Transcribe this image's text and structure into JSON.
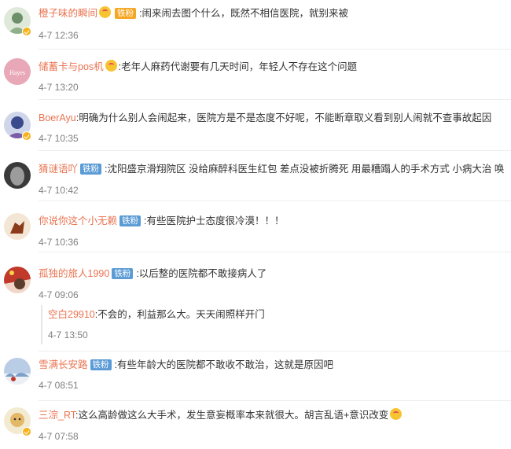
{
  "comments": [
    {
      "user": "橙子味的瞬间",
      "badge": "铁粉",
      "badge_style": "hot",
      "has_emoji": true,
      "text": ":闹来闹去图个什么，既然不相信医院，就别来被",
      "time": "4-7 12:36"
    },
    {
      "user": "储蓄卡与pos机",
      "badge": "",
      "has_emoji": true,
      "text": ":老年人麻药代谢要有几天时间，年轻人不存在这个问题",
      "time": "4-7 13:20"
    },
    {
      "user": "BoerAyu",
      "badge": "",
      "has_emoji": false,
      "text": ":明确为什么别人会闹起来，医院方是不是态度不好呢，不能断章取义看到别人闹就不查事故起因",
      "time": "4-7 10:35"
    },
    {
      "user": "猜谜语吖",
      "badge": "铁粉",
      "has_emoji": false,
      "text": ":沈阳盛京滑翔院区 没给麻醉科医生红包 差点没被折腾死 用最糟蹋人的手术方式 小病大治 唤",
      "time": "4-7 10:42"
    },
    {
      "user": "你说你这个小无赖",
      "badge": "铁粉",
      "has_emoji": false,
      "text": ":有些医院护士态度很冷漠！！！",
      "time": "4-7 10:36"
    },
    {
      "user": "孤独的旅人1990",
      "badge": "铁粉",
      "has_emoji": false,
      "text": ":以后整的医院都不敢接病人了",
      "time": "4-7 09:06"
    },
    {
      "user": "雪满长安路",
      "badge": "铁粉",
      "has_emoji": false,
      "text": ":有些年龄大的医院都不敢收不敢治，这就是原因吧",
      "time": "4-7 08:51"
    },
    {
      "user": "三淙_RT",
      "badge": "",
      "has_emoji": false,
      "text": ":这么高龄做这么大手术，发生意妄概率本来就很大。胡言乱语+意识改变",
      "time": "4-7 07:58"
    }
  ],
  "reply": {
    "user": "空白29910",
    "text": ":不会的，利益那么大。天天闹照样开门",
    "time": "4-7 13:50"
  },
  "avatar_colors": [
    "#8fb08a",
    "#e9a8b8",
    "#3b4a8c",
    "#6b6b6b",
    "#d97a4a",
    "#c0392b",
    "#7da0c8",
    "#e3b867"
  ]
}
